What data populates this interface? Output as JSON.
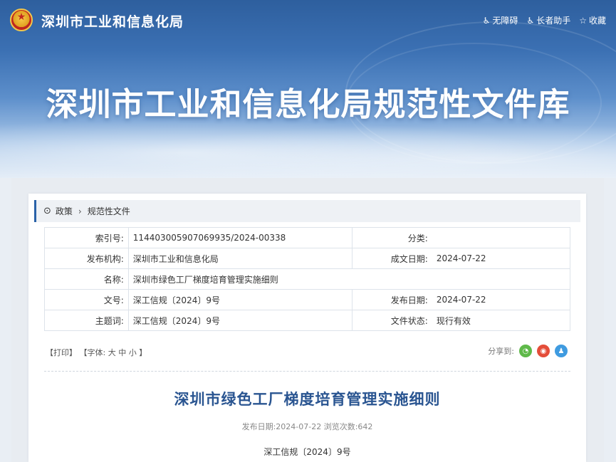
{
  "header": {
    "site_name": "深圳市工业和信息化局",
    "links": [
      {
        "icon": "accessibility-icon",
        "label": "无障碍"
      },
      {
        "icon": "elderly-icon",
        "label": "长者助手"
      },
      {
        "icon": "star-icon",
        "label": "收藏"
      }
    ],
    "banner_title": "深圳市工业和信息化局规范性文件库"
  },
  "breadcrumb": {
    "items": [
      "政策",
      "规范性文件"
    ]
  },
  "meta": {
    "index_label": "索引号:",
    "index_value": "114403005907069935/2024-00338",
    "category_label": "分类:",
    "category_value": "",
    "publisher_label": "发布机构:",
    "publisher_value": "深圳市工业和信息化局",
    "created_label": "成文日期:",
    "created_value": "2024-07-22",
    "name_label": "名称:",
    "name_value": "深圳市绿色工厂梯度培育管理实施细则",
    "docno_label": "文号:",
    "docno_value": "深工信规〔2024〕9号",
    "pubdate_label": "发布日期:",
    "pubdate_value": "2024-07-22",
    "subject_label": "主题词:",
    "subject_value": "深工信规〔2024〕9号",
    "status_label": "文件状态:",
    "status_value": "现行有效"
  },
  "tools": {
    "print": "【打印】",
    "font_prefix": "【字体:",
    "font_large": "大",
    "font_medium": "中",
    "font_small": "小",
    "font_suffix": "】",
    "share_label": "分享到:"
  },
  "article": {
    "title": "深圳市绿色工厂梯度培育管理实施细则",
    "meta_line": "发布日期:2024-07-22   浏览次数:642",
    "doc_no": "深工信规〔2024〕9号"
  }
}
